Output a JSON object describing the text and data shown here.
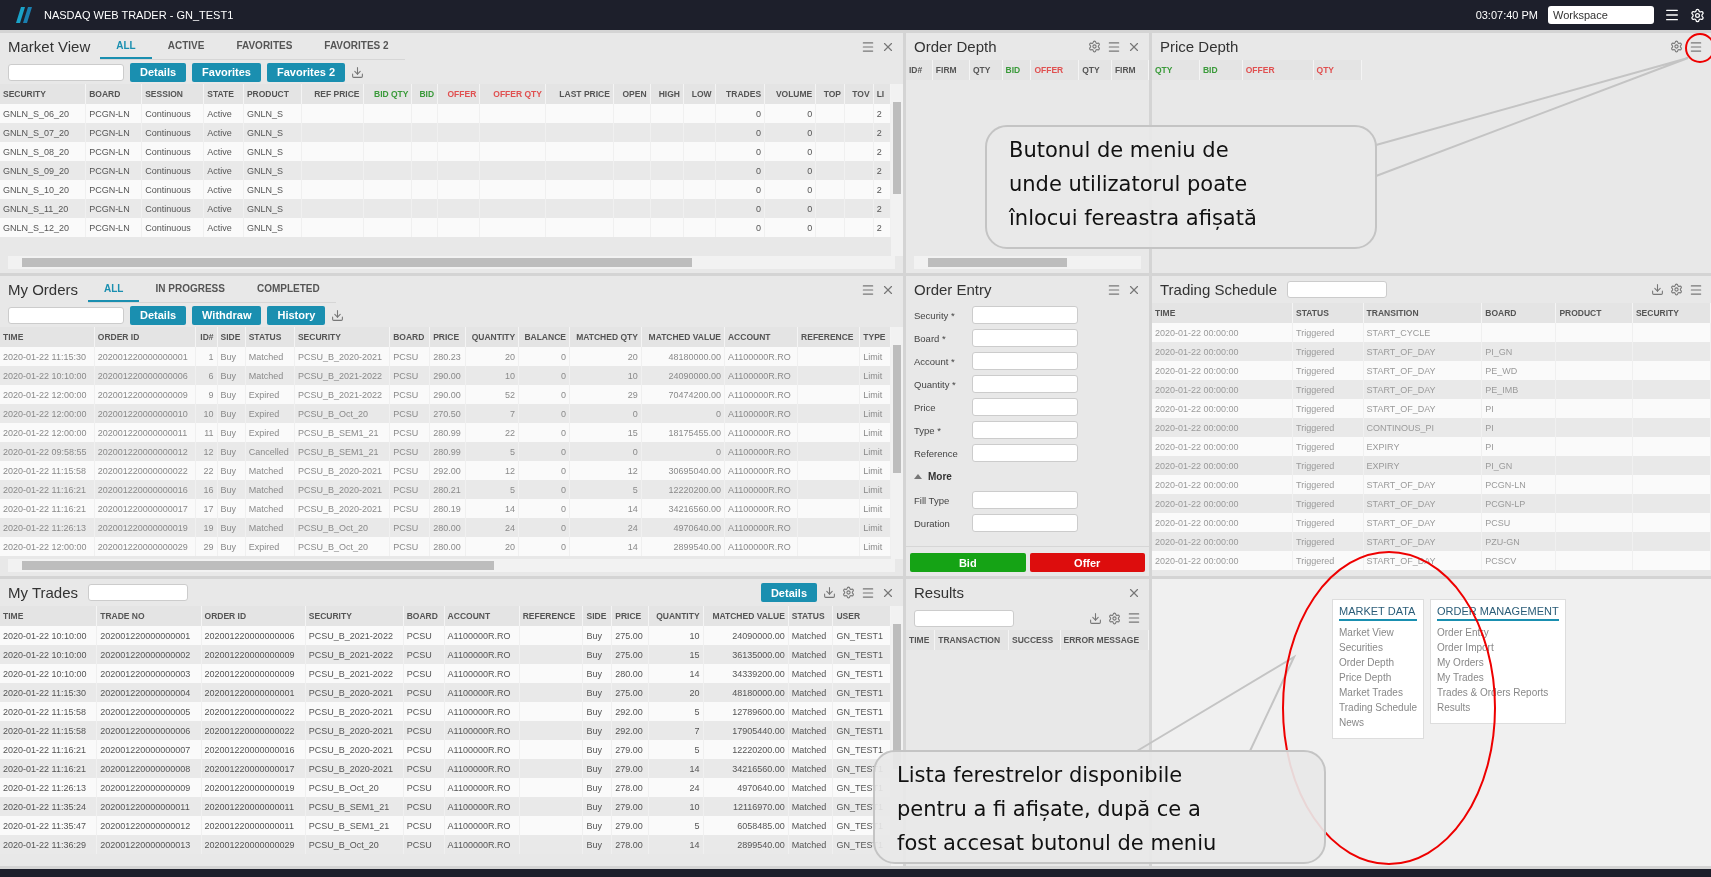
{
  "topbar": {
    "title": "NASDAQ WEB TRADER - GN_TEST1",
    "time": "03:07:40 PM",
    "workspace": "Workspace"
  },
  "market_view": {
    "title": "Market View",
    "tabs": [
      {
        "label": "ALL",
        "selected": true
      },
      {
        "label": "ACTIVE",
        "selected": false
      },
      {
        "label": "FAVORITES",
        "selected": false
      },
      {
        "label": "FAVORITES 2",
        "selected": false
      }
    ],
    "buttons": [
      "Details",
      "Favorites",
      "Favorites 2"
    ],
    "columns": [
      {
        "label": "SECURITY",
        "numeric": false
      },
      {
        "label": "BOARD",
        "numeric": false
      },
      {
        "label": "SESSION",
        "numeric": false
      },
      {
        "label": "STATE",
        "numeric": false
      },
      {
        "label": "PRODUCT",
        "numeric": false
      },
      {
        "label": "REF PRICE",
        "numeric": true
      },
      {
        "label": "BID QTY",
        "numeric": true,
        "color": "#3a9a3a"
      },
      {
        "label": "BID",
        "numeric": true,
        "color": "#3a9a3a"
      },
      {
        "label": "OFFER",
        "numeric": true,
        "color": "#e05050"
      },
      {
        "label": "OFFER QTY",
        "numeric": true,
        "color": "#e05050"
      },
      {
        "label": "LAST PRICE",
        "numeric": true
      },
      {
        "label": "OPEN",
        "numeric": true
      },
      {
        "label": "HIGH",
        "numeric": true
      },
      {
        "label": "LOW",
        "numeric": true
      },
      {
        "label": "TRADES",
        "numeric": true
      },
      {
        "label": "VOLUME",
        "numeric": true
      },
      {
        "label": "TOP",
        "numeric": true
      },
      {
        "label": "TOV",
        "numeric": true
      },
      {
        "label": "LI",
        "numeric": false
      }
    ],
    "rows": [
      [
        "GNLN_S_06_20",
        "PCGN-LN",
        "Continuous",
        "Active",
        "GNLN_S",
        null,
        null,
        null,
        null,
        null,
        null,
        null,
        null,
        null,
        "0",
        "0",
        null,
        null,
        "2"
      ],
      [
        "GNLN_S_07_20",
        "PCGN-LN",
        "Continuous",
        "Active",
        "GNLN_S",
        null,
        null,
        null,
        null,
        null,
        null,
        null,
        null,
        null,
        "0",
        "0",
        null,
        null,
        "2"
      ],
      [
        "GNLN_S_08_20",
        "PCGN-LN",
        "Continuous",
        "Active",
        "GNLN_S",
        null,
        null,
        null,
        null,
        null,
        null,
        null,
        null,
        null,
        "0",
        "0",
        null,
        null,
        "2"
      ],
      [
        "GNLN_S_09_20",
        "PCGN-LN",
        "Continuous",
        "Active",
        "GNLN_S",
        null,
        null,
        null,
        null,
        null,
        null,
        null,
        null,
        null,
        "0",
        "0",
        null,
        null,
        "2"
      ],
      [
        "GNLN_S_10_20",
        "PCGN-LN",
        "Continuous",
        "Active",
        "GNLN_S",
        null,
        null,
        null,
        null,
        null,
        null,
        null,
        null,
        null,
        "0",
        "0",
        null,
        null,
        "2"
      ],
      [
        "GNLN_S_11_20",
        "PCGN-LN",
        "Continuous",
        "Active",
        "GNLN_S",
        null,
        null,
        null,
        null,
        null,
        null,
        null,
        null,
        null,
        "0",
        "0",
        null,
        null,
        "2"
      ],
      [
        "GNLN_S_12_20",
        "PCGN-LN",
        "Continuous",
        "Active",
        "GNLN_S",
        null,
        null,
        null,
        null,
        null,
        null,
        null,
        null,
        null,
        "0",
        "0",
        null,
        null,
        "2"
      ]
    ]
  },
  "order_depth": {
    "title": "Order Depth",
    "columns": [
      {
        "label": "ID#",
        "numeric": false
      },
      {
        "label": "FIRM",
        "numeric": false
      },
      {
        "label": "QTY",
        "numeric": false
      },
      {
        "label": "BID",
        "numeric": false,
        "color": "#3a9a3a"
      },
      {
        "label": "OFFER",
        "numeric": false,
        "color": "#e05050"
      },
      {
        "label": "QTY",
        "numeric": false
      },
      {
        "label": "FIRM",
        "numeric": false
      }
    ]
  },
  "price_depth": {
    "title": "Price Depth",
    "columns": [
      {
        "label": "QTY",
        "numeric": false,
        "color": "#3a9a3a"
      },
      {
        "label": "BID",
        "numeric": false,
        "color": "#3a9a3a"
      },
      {
        "label": "OFFER",
        "numeric": false,
        "color": "#e05050"
      },
      {
        "label": "QTY",
        "numeric": false,
        "color": "#e05050"
      }
    ]
  },
  "my_orders": {
    "title": "My Orders",
    "tabs": [
      {
        "label": "ALL",
        "selected": true
      },
      {
        "label": "IN PROGRESS",
        "selected": false
      },
      {
        "label": "COMPLETED",
        "selected": false
      }
    ],
    "buttons": [
      "Details",
      "Withdraw",
      "History"
    ],
    "columns": [
      {
        "label": "TIME",
        "numeric": false
      },
      {
        "label": "ORDER ID",
        "numeric": false
      },
      {
        "label": "ID#",
        "numeric": true
      },
      {
        "label": "SIDE",
        "numeric": false
      },
      {
        "label": "STATUS",
        "numeric": false
      },
      {
        "label": "SECURITY",
        "numeric": false
      },
      {
        "label": "BOARD",
        "numeric": false
      },
      {
        "label": "PRICE",
        "numeric": false
      },
      {
        "label": "QUANTITY",
        "numeric": true
      },
      {
        "label": "BALANCE",
        "numeric": true
      },
      {
        "label": "MATCHED QTY",
        "numeric": true
      },
      {
        "label": "MATCHED VALUE",
        "numeric": true
      },
      {
        "label": "ACCOUNT",
        "numeric": false
      },
      {
        "label": "REFERENCE",
        "numeric": false
      },
      {
        "label": "TYPE",
        "numeric": false
      }
    ],
    "rows": [
      [
        "2020-01-22 11:15:30",
        "202001220000000001",
        "1",
        "Buy",
        "Matched",
        "PCSU_B_2020-2021",
        "PCSU",
        "280.23",
        "20",
        "0",
        "20",
        "48180000.00",
        "A1100000R.RO",
        null,
        "Limit"
      ],
      [
        "2020-01-22 10:10:00",
        "202001220000000006",
        "6",
        "Buy",
        "Matched",
        "PCSU_B_2021-2022",
        "PCSU",
        "290.00",
        "10",
        "0",
        "10",
        "24090000.00",
        "A1100000R.RO",
        null,
        "Limit"
      ],
      [
        "2020-01-22 12:00:00",
        "202001220000000009",
        "9",
        "Buy",
        "Expired",
        "PCSU_B_2021-2022",
        "PCSU",
        "290.00",
        "52",
        "0",
        "29",
        "70474200.00",
        "A1100000R.RO",
        null,
        "Limit"
      ],
      [
        "2020-01-22 12:00:00",
        "202001220000000010",
        "10",
        "Buy",
        "Expired",
        "PCSU_B_Oct_20",
        "PCSU",
        "270.50",
        "7",
        "0",
        "0",
        "0",
        "A1100000R.RO",
        null,
        "Limit"
      ],
      [
        "2020-01-22 12:00:00",
        "202001220000000011",
        "11",
        "Buy",
        "Expired",
        "PCSU_B_SEM1_21",
        "PCSU",
        "280.99",
        "22",
        "0",
        "15",
        "18175455.00",
        "A1100000R.RO",
        null,
        "Limit"
      ],
      [
        "2020-01-22 09:58:55",
        "202001220000000012",
        "12",
        "Buy",
        "Cancelled",
        "PCSU_B_SEM1_21",
        "PCSU",
        "280.99",
        "5",
        "0",
        "0",
        "0",
        "A1100000R.RO",
        null,
        "Limit"
      ],
      [
        "2020-01-22 11:15:58",
        "202001220000000022",
        "22",
        "Buy",
        "Matched",
        "PCSU_B_2020-2021",
        "PCSU",
        "292.00",
        "12",
        "0",
        "12",
        "30695040.00",
        "A1100000R.RO",
        null,
        "Limit"
      ],
      [
        "2020-01-22 11:16:21",
        "202001220000000016",
        "16",
        "Buy",
        "Matched",
        "PCSU_B_2020-2021",
        "PCSU",
        "280.21",
        "5",
        "0",
        "5",
        "12220200.00",
        "A1100000R.RO",
        null,
        "Limit"
      ],
      [
        "2020-01-22 11:16:21",
        "202001220000000017",
        "17",
        "Buy",
        "Matched",
        "PCSU_B_2020-2021",
        "PCSU",
        "280.19",
        "14",
        "0",
        "14",
        "34216560.00",
        "A1100000R.RO",
        null,
        "Limit"
      ],
      [
        "2020-01-22 11:26:13",
        "202001220000000019",
        "19",
        "Buy",
        "Matched",
        "PCSU_B_Oct_20",
        "PCSU",
        "280.00",
        "24",
        "0",
        "24",
        "4970640.00",
        "A1100000R.RO",
        null,
        "Limit"
      ],
      [
        "2020-01-22 12:00:00",
        "202001220000000029",
        "29",
        "Buy",
        "Expired",
        "PCSU_B_Oct_20",
        "PCSU",
        "280.00",
        "20",
        "0",
        "14",
        "2899540.00",
        "A1100000R.RO",
        null,
        "Limit"
      ]
    ]
  },
  "order_entry": {
    "title": "Order Entry",
    "fields": [
      {
        "label": "Security *"
      },
      {
        "label": "Board *"
      },
      {
        "label": "Account *"
      },
      {
        "label": "Quantity *"
      },
      {
        "label": "Price"
      },
      {
        "label": "Type *"
      },
      {
        "label": "Reference"
      }
    ],
    "more": {
      "label": "More",
      "expanded": true
    },
    "more_fields": [
      {
        "label": "Fill Type"
      },
      {
        "label": "Duration"
      }
    ],
    "actions": [
      {
        "label": "Bid",
        "kind": "bid"
      },
      {
        "label": "Offer",
        "kind": "offer"
      }
    ]
  },
  "trading_schedule": {
    "title": "Trading Schedule",
    "columns": [
      {
        "label": "TIME",
        "numeric": false
      },
      {
        "label": "STATUS",
        "numeric": false
      },
      {
        "label": "TRANSITION",
        "numeric": false
      },
      {
        "label": "BOARD",
        "numeric": false
      },
      {
        "label": "PRODUCT",
        "numeric": false
      },
      {
        "label": "SECURITY",
        "numeric": false
      }
    ],
    "rows": [
      [
        "2020-01-22 00:00:00",
        "Triggered",
        "START_CYCLE",
        null,
        null,
        null
      ],
      [
        "2020-01-22 00:00:00",
        "Triggered",
        "START_OF_DAY",
        "PI_GN",
        null,
        null
      ],
      [
        "2020-01-22 00:00:00",
        "Triggered",
        "START_OF_DAY",
        "PE_WD",
        null,
        null
      ],
      [
        "2020-01-22 00:00:00",
        "Triggered",
        "START_OF_DAY",
        "PE_IMB",
        null,
        null
      ],
      [
        "2020-01-22 00:00:00",
        "Triggered",
        "START_OF_DAY",
        "PI",
        null,
        null
      ],
      [
        "2020-01-22 00:00:00",
        "Triggered",
        "CONTINOUS_PI",
        "PI",
        null,
        null
      ],
      [
        "2020-01-22 00:00:00",
        "Triggered",
        "EXPIRY",
        "PI",
        null,
        null
      ],
      [
        "2020-01-22 00:00:00",
        "Triggered",
        "EXPIRY",
        "PI_GN",
        null,
        null
      ],
      [
        "2020-01-22 00:00:00",
        "Triggered",
        "START_OF_DAY",
        "PCGN-LN",
        null,
        null
      ],
      [
        "2020-01-22 00:00:00",
        "Triggered",
        "START_OF_DAY",
        "PCGN-LP",
        null,
        null
      ],
      [
        "2020-01-22 00:00:00",
        "Triggered",
        "START_OF_DAY",
        "PCSU",
        null,
        null
      ],
      [
        "2020-01-22 00:00:00",
        "Triggered",
        "START_OF_DAY",
        "PZU-GN",
        null,
        null
      ],
      [
        "2020-01-22 00:00:00",
        "Triggered",
        "START_OF_DAY",
        "PCSCV",
        null,
        null
      ]
    ]
  },
  "my_trades": {
    "title": "My Trades",
    "button": "Details",
    "columns": [
      {
        "label": "TIME",
        "numeric": false
      },
      {
        "label": "TRADE NO",
        "numeric": false
      },
      {
        "label": "ORDER ID",
        "numeric": false
      },
      {
        "label": "SECURITY",
        "numeric": false
      },
      {
        "label": "BOARD",
        "numeric": false
      },
      {
        "label": "ACCOUNT",
        "numeric": false
      },
      {
        "label": "REFERENCE",
        "numeric": false
      },
      {
        "label": "SIDE",
        "numeric": false
      },
      {
        "label": "PRICE",
        "numeric": false
      },
      {
        "label": "QUANTITY",
        "numeric": true
      },
      {
        "label": "MATCHED VALUE",
        "numeric": true
      },
      {
        "label": "STATUS",
        "numeric": false
      },
      {
        "label": "USER",
        "numeric": false
      }
    ],
    "rows": [
      [
        "2020-01-22 10:10:00",
        "202001220000000001",
        "202001220000000006",
        "PCSU_B_2021-2022",
        "PCSU",
        "A1100000R.RO",
        null,
        "Buy",
        "275.00",
        "10",
        "24090000.00",
        "Matched",
        "GN_TEST1"
      ],
      [
        "2020-01-22 10:10:00",
        "202001220000000002",
        "202001220000000009",
        "PCSU_B_2021-2022",
        "PCSU",
        "A1100000R.RO",
        null,
        "Buy",
        "275.00",
        "15",
        "36135000.00",
        "Matched",
        "GN_TEST1"
      ],
      [
        "2020-01-22 10:10:00",
        "202001220000000003",
        "202001220000000009",
        "PCSU_B_2021-2022",
        "PCSU",
        "A1100000R.RO",
        null,
        "Buy",
        "280.00",
        "14",
        "34339200.00",
        "Matched",
        "GN_TEST1"
      ],
      [
        "2020-01-22 11:15:30",
        "202001220000000004",
        "202001220000000001",
        "PCSU_B_2020-2021",
        "PCSU",
        "A1100000R.RO",
        null,
        "Buy",
        "275.00",
        "20",
        "48180000.00",
        "Matched",
        "GN_TEST1"
      ],
      [
        "2020-01-22 11:15:58",
        "202001220000000005",
        "202001220000000022",
        "PCSU_B_2020-2021",
        "PCSU",
        "A1100000R.RO",
        null,
        "Buy",
        "292.00",
        "5",
        "12789600.00",
        "Matched",
        "GN_TEST1"
      ],
      [
        "2020-01-22 11:15:58",
        "202001220000000006",
        "202001220000000022",
        "PCSU_B_2020-2021",
        "PCSU",
        "A1100000R.RO",
        null,
        "Buy",
        "292.00",
        "7",
        "17905440.00",
        "Matched",
        "GN_TEST1"
      ],
      [
        "2020-01-22 11:16:21",
        "202001220000000007",
        "202001220000000016",
        "PCSU_B_2020-2021",
        "PCSU",
        "A1100000R.RO",
        null,
        "Buy",
        "279.00",
        "5",
        "12220200.00",
        "Matched",
        "GN_TEST1"
      ],
      [
        "2020-01-22 11:16:21",
        "202001220000000008",
        "202001220000000017",
        "PCSU_B_2020-2021",
        "PCSU",
        "A1100000R.RO",
        null,
        "Buy",
        "279.00",
        "14",
        "34216560.00",
        "Matched",
        "GN_TEST1"
      ],
      [
        "2020-01-22 11:26:13",
        "202001220000000009",
        "202001220000000019",
        "PCSU_B_Oct_20",
        "PCSU",
        "A1100000R.RO",
        null,
        "Buy",
        "278.00",
        "24",
        "4970640.00",
        "Matched",
        "GN_TEST1"
      ],
      [
        "2020-01-22 11:35:24",
        "202001220000000011",
        "202001220000000011",
        "PCSU_B_SEM1_21",
        "PCSU",
        "A1100000R.RO",
        null,
        "Buy",
        "279.00",
        "10",
        "12116970.00",
        "Matched",
        "GN_TEST1"
      ],
      [
        "2020-01-22 11:35:47",
        "202001220000000012",
        "202001220000000011",
        "PCSU_B_SEM1_21",
        "PCSU",
        "A1100000R.RO",
        null,
        "Buy",
        "279.00",
        "5",
        "6058485.00",
        "Matched",
        "GN_TEST1"
      ],
      [
        "2020-01-22 11:36:29",
        "202001220000000013",
        "202001220000000029",
        "PCSU_B_Oct_20",
        "PCSU",
        "A1100000R.RO",
        null,
        "Buy",
        "278.00",
        "14",
        "2899540.00",
        "Matched",
        "GN_TEST1"
      ]
    ]
  },
  "results": {
    "title": "Results",
    "columns": [
      {
        "label": "TIME",
        "numeric": false
      },
      {
        "label": "TRANSACTION",
        "numeric": false
      },
      {
        "label": "SUCCESS",
        "numeric": false
      },
      {
        "label": "ERROR MESSAGE",
        "numeric": false
      }
    ]
  },
  "window_menu": {
    "groups": [
      {
        "title": "MARKET DATA",
        "items": [
          "Market View",
          "Securities",
          "Order Depth",
          "Price Depth",
          "Market Trades",
          "Trading Schedule",
          "News"
        ]
      },
      {
        "title": "ORDER MANAGEMENT",
        "items": [
          "Order Entry",
          "Order Import",
          "My Orders",
          "My Trades",
          "Trades & Orders Reports",
          "Results"
        ]
      }
    ]
  },
  "callouts": [
    {
      "text": "Butonul de meniu de\nunde utilizatorul poate\nînlocui fereastra afișată"
    },
    {
      "text": "Lista ferestrelor disponibile\npentru a fi afișate, după ce a\nfost accesat butonul de meniu"
    }
  ]
}
